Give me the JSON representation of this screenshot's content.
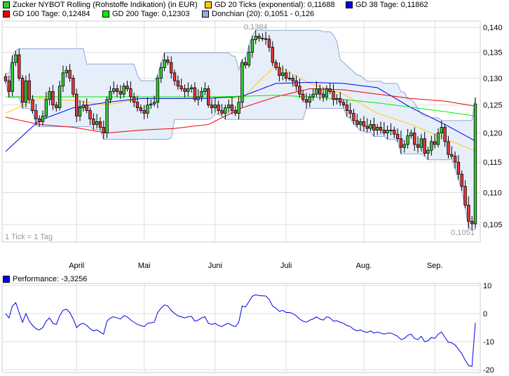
{
  "legend": [
    {
      "label": "Zucker NYBOT Rolling (Rohstoffe Indikation) (in EUR)",
      "color": "#33cc33"
    },
    {
      "label": "GD 20 Ticks (exponential): 0,11688",
      "color": "#ffcc00"
    },
    {
      "label": "GD 38 Tage: 0,11862",
      "color": "#0000ee"
    },
    {
      "label": "GD 100 Tage: 0,12484",
      "color": "#ee0000"
    },
    {
      "label": "GD 200 Tage: 0,12303",
      "color": "#00ee00"
    },
    {
      "label": "Donchian (20): 0,1051 - 0,126",
      "color": "#99aadd"
    }
  ],
  "perf_legend": {
    "label": "Performance: -3,3256",
    "color": "#0000ee"
  },
  "tick_note": "1 Tick = 1 Tag",
  "chart_data": [
    {
      "type": "candlestick",
      "title": "Zucker NYBOT Rolling (Rohstoffe Indikation) (in EUR)",
      "scale": "log",
      "ylim": [
        0.1035,
        0.1415
      ],
      "y_ticks": [
        "0,140",
        "0,135",
        "0,130",
        "0,125",
        "0,120",
        "0,115",
        "0,110",
        "0,105"
      ],
      "y_tick_values": [
        0.14,
        0.135,
        0.13,
        0.125,
        0.12,
        0.115,
        0.11,
        0.105
      ],
      "x_labels": [
        "April",
        "Mai",
        "Juni",
        "Juli",
        "Aug.",
        "Sep."
      ],
      "x_label_index": [
        21,
        41,
        62,
        83,
        106,
        127
      ],
      "annotations": {
        "high": "0,1384",
        "low": "0,1051"
      },
      "closes": [
        0.1295,
        0.1275,
        0.133,
        0.1345,
        0.13,
        0.1255,
        0.1295,
        0.126,
        0.124,
        0.1225,
        0.122,
        0.123,
        0.126,
        0.1275,
        0.125,
        0.1245,
        0.1285,
        0.131,
        0.1315,
        0.13,
        0.127,
        0.123,
        0.1245,
        0.125,
        0.124,
        0.1225,
        0.1215,
        0.122,
        0.121,
        0.12,
        0.126,
        0.1275,
        0.128,
        0.1275,
        0.127,
        0.1285,
        0.128,
        0.1265,
        0.1255,
        0.1245,
        0.124,
        0.1235,
        0.125,
        0.1252,
        0.1255,
        0.13,
        0.132,
        0.1335,
        0.133,
        0.131,
        0.1295,
        0.1285,
        0.128,
        0.1275,
        0.128,
        0.1282,
        0.126,
        0.1265,
        0.1275,
        0.128,
        0.125,
        0.1245,
        0.125,
        0.124,
        0.1235,
        0.1245,
        0.125,
        0.124,
        0.1235,
        0.1255,
        0.133,
        0.1325,
        0.135,
        0.1375,
        0.1382,
        0.1378,
        0.1377,
        0.1376,
        0.136,
        0.133,
        0.132,
        0.1305,
        0.131,
        0.13,
        0.13,
        0.1295,
        0.1285,
        0.127,
        0.126,
        0.1255,
        0.1265,
        0.127,
        0.128,
        0.127,
        0.1265,
        0.128,
        0.1275,
        0.126,
        0.1262,
        0.1255,
        0.125,
        0.124,
        0.1235,
        0.1222,
        0.1215,
        0.122,
        0.1212,
        0.1208,
        0.1215,
        0.1205,
        0.121,
        0.1205,
        0.12,
        0.1205,
        0.1205,
        0.1198,
        0.119,
        0.1175,
        0.118,
        0.1195,
        0.12,
        0.118,
        0.1175,
        0.119,
        0.1165,
        0.117,
        0.1185,
        0.118,
        0.12,
        0.121,
        0.1185,
        0.1163,
        0.116,
        0.115,
        0.113,
        0.111,
        0.108,
        0.1055,
        0.1051,
        0.1252
      ],
      "ma_sample_index": [
        0,
        10,
        20,
        30,
        40,
        50,
        60,
        70,
        80,
        90,
        100,
        110,
        120,
        130,
        139
      ],
      "ma_series": [
        {
          "name": "GD 20 Ticks (exponential)",
          "color": "#ffcc00",
          "values": [
            0.1235,
            0.1262,
            0.1258,
            0.125,
            0.1262,
            0.1262,
            0.1265,
            0.1262,
            0.1325,
            0.129,
            0.127,
            0.1235,
            0.1215,
            0.119,
            0.1169
          ]
        },
        {
          "name": "GD 38 Tage",
          "color": "#0000ee",
          "values": [
            0.1168,
            0.1222,
            0.1245,
            0.1255,
            0.1262,
            0.1262,
            0.1262,
            0.1266,
            0.129,
            0.1292,
            0.129,
            0.1282,
            0.1245,
            0.1215,
            0.1186
          ]
        },
        {
          "name": "GD 100 Tage",
          "color": "#ee0000",
          "values": [
            0.1228,
            0.1215,
            0.121,
            0.12,
            0.1205,
            0.1208,
            0.1215,
            0.1245,
            0.1265,
            0.128,
            0.1278,
            0.127,
            0.1262,
            0.1257,
            0.1248
          ]
        },
        {
          "name": "GD 200 Tage",
          "color": "#00ee00",
          "values": [
            0.1265,
            0.1265,
            0.1265,
            0.1265,
            0.1265,
            0.1265,
            0.1265,
            0.1266,
            0.1268,
            0.1265,
            0.126,
            0.1254,
            0.1246,
            0.1238,
            0.123
          ]
        }
      ],
      "donchian_period": 20
    },
    {
      "type": "line",
      "title": "Performance",
      "ylim": [
        -22,
        12
      ],
      "y_ticks": [
        "10",
        "0",
        "-10",
        "-20"
      ],
      "y_tick_values": [
        10,
        0,
        -10,
        -20
      ],
      "final_value": -3.3256
    }
  ]
}
